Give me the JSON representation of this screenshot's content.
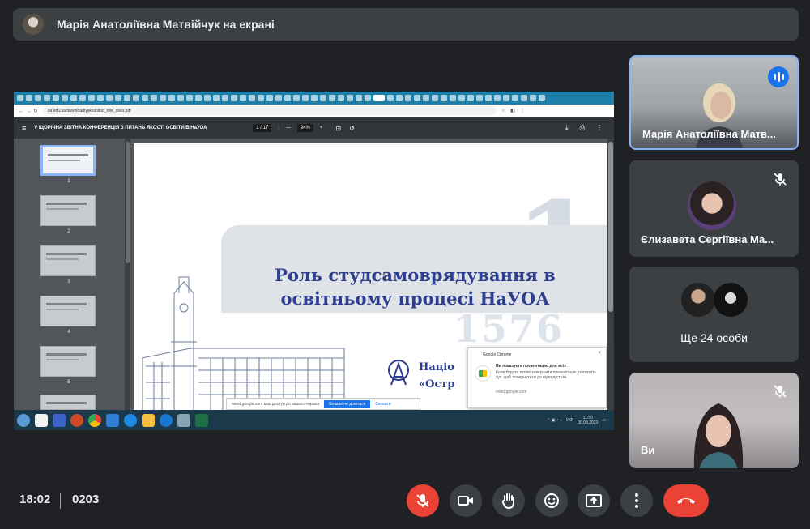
{
  "banner": {
    "text": "Марія Анатоліївна Матвійчук на екрані"
  },
  "shared_screen": {
    "url": "oa.edu.ua/download/yakist/stud_role_osvu.pdf",
    "pdf_title": "V ЩОРІЧНА ЗВІТНА КОНФЕРЕНЦІЯ З ПИТАНЬ ЯКОСТІ ОСВІТИ В НаУОА",
    "page_indicator": "1 / 17",
    "zoom": "94%",
    "thumbnails": [
      "1",
      "2",
      "3",
      "4",
      "5"
    ],
    "slide": {
      "heading_line1": "Роль студсамоврядування в",
      "heading_line2": "освітньому процесі НаУОА",
      "year_watermark": "1576",
      "university_line1": "Націо",
      "university_line2": "«Остр"
    },
    "share_strip": {
      "text": "meet.google.com має доступ до вашого екрана",
      "stop_label": "Більше не ділитися",
      "hide_label": "Сховати"
    },
    "notification": {
      "app": "Google Chrome",
      "title": "Ви показуєте презентацію для всіх",
      "body": "Коли будете готові завершити презентацію, натисніть тут, щоб повернутися до відеозустрічі.",
      "site": "meet.google.com"
    },
    "tray": {
      "lang": "УКР",
      "time": "11:50",
      "date": "30.03.2023"
    }
  },
  "participants": [
    {
      "name": "Марія Анатоліївна Матв...",
      "status": "speaking"
    },
    {
      "name": "Єлизавета Сергіївна Ма...",
      "status": "muted"
    },
    {
      "more_label": "Ще 24 особи"
    },
    {
      "name": "Ви",
      "status": "muted"
    }
  ],
  "footer": {
    "time": "18:02",
    "meeting_code": "0203",
    "controls": [
      "mic-off",
      "camera",
      "raise-hand",
      "reactions",
      "present",
      "more",
      "leave-call"
    ]
  },
  "colors": {
    "accent": "#8ab4f8",
    "danger": "#ea4335",
    "bg": "#202124",
    "tile": "#3c4043",
    "slide_title": "#2e3e8f"
  }
}
